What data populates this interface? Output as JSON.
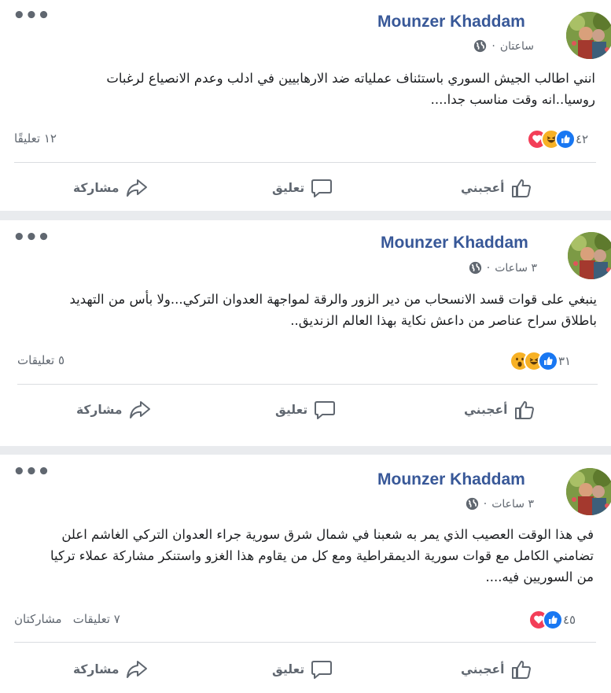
{
  "posts": [
    {
      "author": "Mounzer Khaddam",
      "time": "ساعتان",
      "separator": "·",
      "text_lines": [
        "انني اطالب الجيش السوري باستئناف عملياته ضد الارهابيين في ادلب وعدم الانصياع لرغبات",
        "روسيا..انه وقت مناسب جدا...."
      ],
      "reactions": [
        "like-icon",
        "haha-icon",
        "love-icon"
      ],
      "reaction_count": "٤٢",
      "comments": "١٢ تعليقًا",
      "shares": ""
    },
    {
      "author": "Mounzer Khaddam",
      "time": "٣ ساعات",
      "separator": "·",
      "text_lines": [
        "ينبغي على قوات قسد الانسحاب من دير الزور والرقة لمواجهة العدوان التركي...ولا بأس من التهديد",
        "باطلاق سراح عناصر من داعش نكاية بهذا العالم الزنديق.."
      ],
      "reactions": [
        "like-icon",
        "haha-icon",
        "wow-icon"
      ],
      "reaction_count": "٣١",
      "comments": "٥ تعليقات",
      "shares": ""
    },
    {
      "author": "Mounzer Khaddam",
      "time": "٣ ساعات",
      "separator": "·",
      "text_lines": [
        "في هذا الوقت العصيب الذي يمر به شعبنا في شمال شرق سورية جراء العدوان التركي الغاشم اعلن",
        "تضامني الكامل مع قوات سورية الديمقراطية ومع كل من يقاوم هذا الغزو واستنكر مشاركة عملاء تركيا",
        "من السوريين فيه...."
      ],
      "reactions": [
        "like-icon",
        "love-icon"
      ],
      "reaction_count": "٤٥",
      "comments": "٧ تعليقات",
      "shares": "مشاركتان"
    }
  ],
  "actions": {
    "like": "أعجبني",
    "comment": "تعليق",
    "share": "مشاركة"
  },
  "colors": {
    "author": "#385898",
    "meta": "#606770",
    "like_blue": "#1877f2",
    "love_red": "#f33e58",
    "haha_yellow": "#f7b125"
  }
}
